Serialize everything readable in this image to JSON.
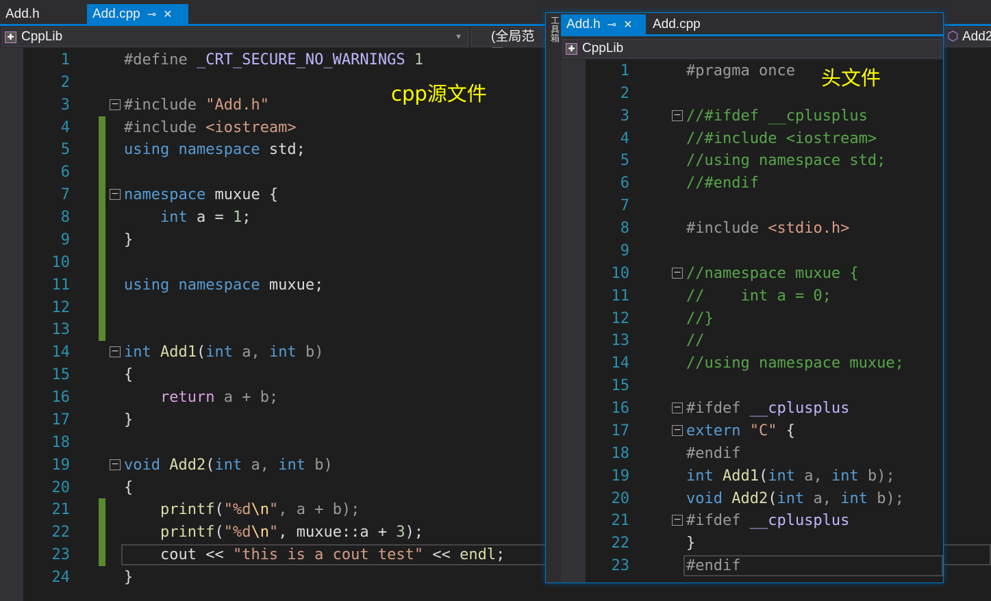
{
  "main": {
    "tabs": [
      {
        "label": "Add.h"
      },
      {
        "label": "Add.cpp",
        "active": true
      }
    ],
    "project": "CppLib",
    "scope": "(全局范围",
    "right_member": "Add2",
    "note": "cpp源文件",
    "folds": [
      3,
      7,
      14,
      19
    ],
    "changed": [
      4,
      5,
      6,
      7,
      8,
      9,
      10,
      11,
      12,
      13,
      21,
      22,
      23
    ],
    "current_line": 23,
    "lines": [
      [
        [
          "#define ",
          "p"
        ],
        [
          "_CRT_SECURE_NO_WARNINGS",
          "m"
        ],
        [
          " 1",
          "n"
        ]
      ],
      [],
      [
        [
          "#include ",
          "p"
        ],
        [
          "\"Add.h\"",
          "s"
        ]
      ],
      [
        [
          "#include ",
          "p"
        ],
        [
          "<iostream>",
          "s"
        ]
      ],
      [
        [
          "using namespace",
          "k"
        ],
        [
          " std;",
          "t"
        ]
      ],
      [],
      [
        [
          "namespace",
          "k"
        ],
        [
          " muxue {",
          "t"
        ]
      ],
      [
        [
          "    ",
          "t"
        ],
        [
          "int",
          "k"
        ],
        [
          " a = ",
          "t"
        ],
        [
          "1",
          "n"
        ],
        [
          ";",
          "t"
        ]
      ],
      [
        [
          "}",
          "t"
        ]
      ],
      [],
      [
        [
          "using namespace",
          "k"
        ],
        [
          " muxue;",
          "t"
        ]
      ],
      [],
      [],
      [
        [
          "int",
          "k"
        ],
        [
          " ",
          "t"
        ],
        [
          "Add1",
          "f"
        ],
        [
          "(",
          "t"
        ],
        [
          "int",
          "k"
        ],
        [
          " a, ",
          "v"
        ],
        [
          "int",
          "k"
        ],
        [
          " b)",
          "v"
        ]
      ],
      [
        [
          "{",
          "t"
        ]
      ],
      [
        [
          "    ",
          "t"
        ],
        [
          "return",
          "r"
        ],
        [
          " a + b;",
          "v"
        ]
      ],
      [
        [
          "}",
          "t"
        ]
      ],
      [],
      [
        [
          "void",
          "k"
        ],
        [
          " ",
          "t"
        ],
        [
          "Add2",
          "f"
        ],
        [
          "(",
          "t"
        ],
        [
          "int",
          "k"
        ],
        [
          " a, ",
          "v"
        ],
        [
          "int",
          "k"
        ],
        [
          " b)",
          "v"
        ]
      ],
      [
        [
          "{",
          "t"
        ]
      ],
      [
        [
          "    ",
          "t"
        ],
        [
          "printf",
          "f"
        ],
        [
          "(",
          "t"
        ],
        [
          "\"%d",
          "s"
        ],
        [
          "\\n",
          "e"
        ],
        [
          "\"",
          "s"
        ],
        [
          ", a + b);",
          "v"
        ]
      ],
      [
        [
          "    ",
          "t"
        ],
        [
          "printf",
          "f"
        ],
        [
          "(",
          "t"
        ],
        [
          "\"%d",
          "s"
        ],
        [
          "\\n",
          "e"
        ],
        [
          "\"",
          "s"
        ],
        [
          ", muxue::a + ",
          "t"
        ],
        [
          "3",
          "n"
        ],
        [
          ");",
          "t"
        ]
      ],
      [
        [
          "    cout << ",
          "t"
        ],
        [
          "\"this is a cout test\"",
          "s"
        ],
        [
          " << ",
          "t"
        ],
        [
          "endl",
          "f"
        ],
        [
          ";",
          "t"
        ]
      ],
      [
        [
          "}",
          "t"
        ]
      ]
    ]
  },
  "float": {
    "side_label": "工具箱",
    "tabs": [
      {
        "label": "Add.h",
        "active": true
      },
      {
        "label": "Add.cpp"
      }
    ],
    "project": "CppLib",
    "note": "头文件",
    "folds": [
      3,
      10,
      16,
      17,
      21
    ],
    "changed": [],
    "current_line": 23,
    "lines": [
      [
        [
          "#pragma once",
          "p"
        ]
      ],
      [],
      [
        [
          "//#ifdef __cplusplus",
          "c"
        ]
      ],
      [
        [
          "//#include <iostream>",
          "c"
        ]
      ],
      [
        [
          "//using namespace std;",
          "c"
        ]
      ],
      [
        [
          "//#endif",
          "c"
        ]
      ],
      [],
      [
        [
          "#include ",
          "p"
        ],
        [
          "<stdio.h>",
          "s"
        ]
      ],
      [],
      [
        [
          "//namespace muxue {",
          "c"
        ]
      ],
      [
        [
          "//    int a = 0;",
          "c"
        ]
      ],
      [
        [
          "//}",
          "c"
        ]
      ],
      [
        [
          "//",
          "c"
        ]
      ],
      [
        [
          "//using namespace muxue;",
          "c"
        ]
      ],
      [],
      [
        [
          "#ifdef ",
          "p"
        ],
        [
          "__cplusplus",
          "m"
        ]
      ],
      [
        [
          "extern",
          "k"
        ],
        [
          " ",
          "t"
        ],
        [
          "\"C\"",
          "s"
        ],
        [
          " {",
          "t"
        ]
      ],
      [
        [
          "#endif",
          "p"
        ]
      ],
      [
        [
          "int",
          "k"
        ],
        [
          " ",
          "t"
        ],
        [
          "Add1",
          "f"
        ],
        [
          "(",
          "t"
        ],
        [
          "int",
          "k"
        ],
        [
          " a, ",
          "v"
        ],
        [
          "int",
          "k"
        ],
        [
          " b);",
          "v"
        ]
      ],
      [
        [
          "void",
          "k"
        ],
        [
          " ",
          "t"
        ],
        [
          "Add2",
          "f"
        ],
        [
          "(",
          "t"
        ],
        [
          "int",
          "k"
        ],
        [
          " a, ",
          "v"
        ],
        [
          "int",
          "k"
        ],
        [
          " b);",
          "v"
        ]
      ],
      [
        [
          "#ifdef ",
          "p"
        ],
        [
          "__cplusplus",
          "m"
        ]
      ],
      [
        [
          "}",
          "t"
        ]
      ],
      [
        [
          "#endif",
          "p"
        ]
      ]
    ]
  }
}
